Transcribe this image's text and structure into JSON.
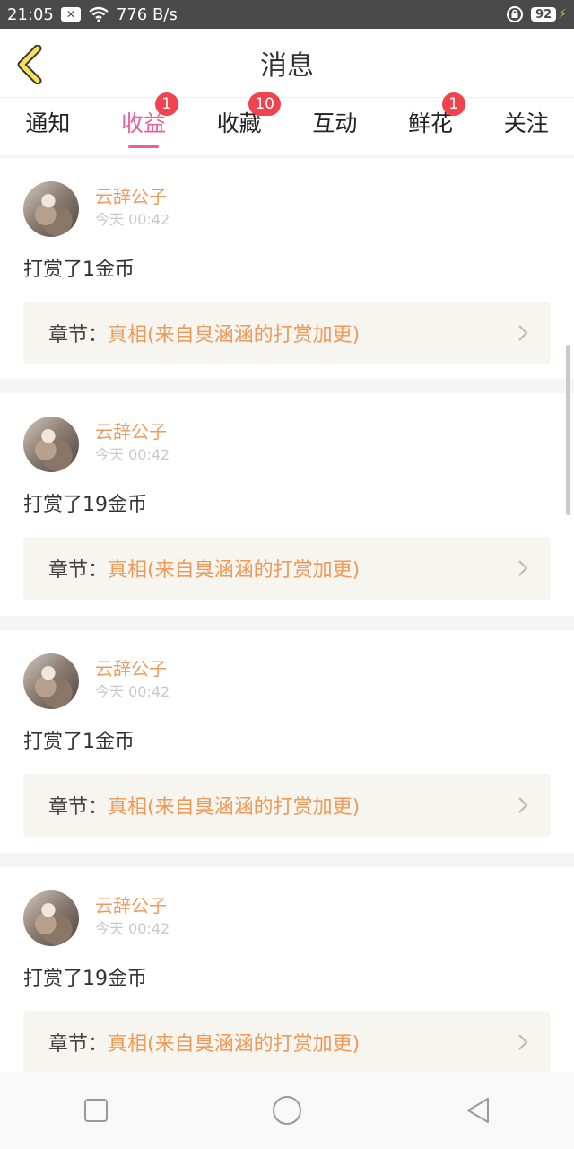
{
  "status_bar": {
    "time": "21:05",
    "notification_icon": "x-box-icon",
    "network_speed": "776 B/s",
    "battery": "92"
  },
  "header": {
    "title": "消息",
    "back_icon": "chevron-left-icon"
  },
  "tabs": [
    {
      "label": "通知",
      "badge": ""
    },
    {
      "label": "收益",
      "badge": "1",
      "active": true
    },
    {
      "label": "收藏",
      "badge": "10"
    },
    {
      "label": "互动",
      "badge": ""
    },
    {
      "label": "鲜花",
      "badge": "1"
    },
    {
      "label": "关注",
      "badge": ""
    }
  ],
  "messages": [
    {
      "username": "云辞公子",
      "time": "今天 00:42",
      "action": "打赏了1金币",
      "chapter_label": "章节：",
      "chapter_title": "真相(来自臭涵涵的打赏加更)"
    },
    {
      "username": "云辞公子",
      "time": "今天 00:42",
      "action": "打赏了19金币",
      "chapter_label": "章节：",
      "chapter_title": "真相(来自臭涵涵的打赏加更)"
    },
    {
      "username": "云辞公子",
      "time": "今天 00:42",
      "action": "打赏了1金币",
      "chapter_label": "章节：",
      "chapter_title": "真相(来自臭涵涵的打赏加更)"
    },
    {
      "username": "云辞公子",
      "time": "今天 00:42",
      "action": "打赏了19金币",
      "chapter_label": "章节：",
      "chapter_title": "真相(来自臭涵涵的打赏加更)"
    }
  ],
  "colors": {
    "accent": "#e8609b",
    "username": "#ee9a5a",
    "badge": "#f0424f",
    "back_arrow": "#f6e05a"
  },
  "nav_bar": {
    "buttons": [
      "square-icon",
      "circle-icon",
      "triangle-back-icon"
    ]
  }
}
